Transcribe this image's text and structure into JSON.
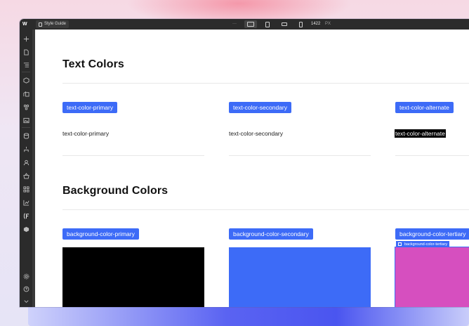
{
  "toolbar": {
    "page_name": "Style Guide",
    "more_label": "···",
    "width_value": "1422",
    "width_unit": "PX"
  },
  "sections": {
    "text_colors": {
      "title": "Text Colors",
      "items": [
        {
          "tag": "text-color-primary",
          "sample": "text-color-primary"
        },
        {
          "tag": "text-color-secondary",
          "sample": "text-color-secondary"
        },
        {
          "tag": "text-color-alternate",
          "sample": "text-color-alternate"
        }
      ]
    },
    "background_colors": {
      "title": "Background Colors",
      "items": [
        {
          "tag": "background-color-primary",
          "color": "#000000"
        },
        {
          "tag": "background-color-secondary",
          "color": "#3d6bf7"
        },
        {
          "tag": "background-color-tertiary",
          "color": "#d64fbf",
          "selected_label": "background-color-tertiary"
        }
      ]
    }
  },
  "colors": {
    "accent": "#3d6bf7",
    "editor_dark": "#2b2b2b"
  }
}
